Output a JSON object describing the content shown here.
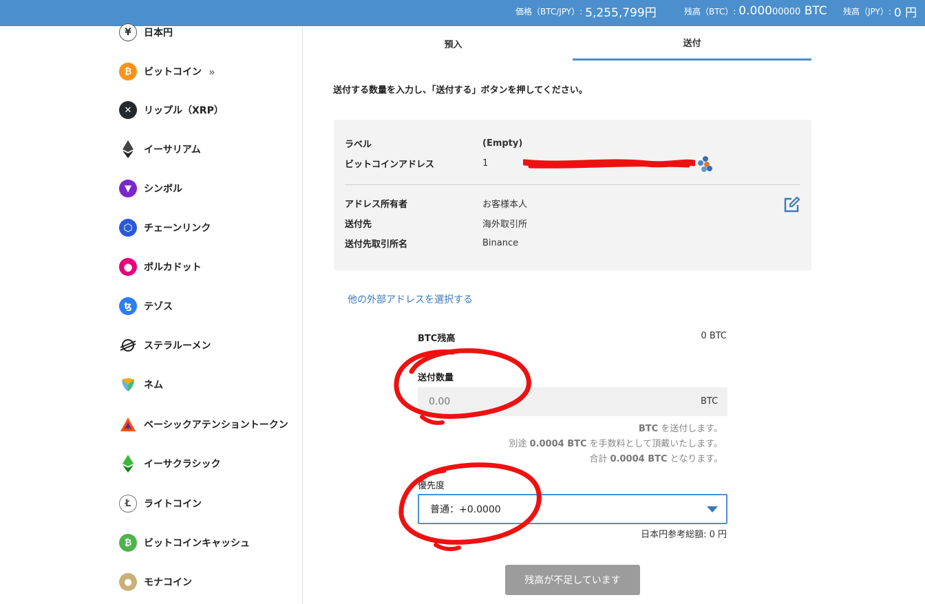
{
  "topbar": {
    "price_label": "価格（BTC/JPY）:",
    "price_value": "5,255,799円",
    "btc_balance_label": "残高（BTC）:",
    "btc_balance_main": "0.000",
    "btc_balance_small": "00000",
    "btc_balance_unit": " BTC",
    "jpy_balance_label": "残高（JPY）:",
    "jpy_balance_value": "0 円"
  },
  "sidebar": {
    "items": [
      {
        "label": "日本円",
        "icon": "yen-icon"
      },
      {
        "label": "ビットコイン",
        "icon": "bitcoin-icon",
        "chevron": "»"
      },
      {
        "label": "リップル（XRP）",
        "icon": "xrp-icon"
      },
      {
        "label": "イーサリアム",
        "icon": "ethereum-icon"
      },
      {
        "label": "シンボル",
        "icon": "symbol-icon"
      },
      {
        "label": "チェーンリンク",
        "icon": "chainlink-icon"
      },
      {
        "label": "ポルカドット",
        "icon": "polkadot-icon"
      },
      {
        "label": "テゾス",
        "icon": "tezos-icon"
      },
      {
        "label": "ステラルーメン",
        "icon": "stellar-icon"
      },
      {
        "label": "ネム",
        "icon": "nem-icon"
      },
      {
        "label": "ベーシックアテンショントークン",
        "icon": "bat-icon"
      },
      {
        "label": "イーサクラシック",
        "icon": "etc-icon"
      },
      {
        "label": "ライトコイン",
        "icon": "litecoin-icon"
      },
      {
        "label": "ビットコインキャッシュ",
        "icon": "bch-icon"
      },
      {
        "label": "モナコイン",
        "icon": "monacoin-icon"
      }
    ]
  },
  "tabs": {
    "deposit": "預入",
    "send": "送付"
  },
  "instruction": "送付する数量を入力し、「送付する」ボタンを押してください。",
  "address_card": {
    "label_key": "ラベル",
    "label_value": "(Empty)",
    "address_key": "ビットコインアドレス",
    "address_value": "1",
    "owner_key": "アドレス所有者",
    "owner_value": "お客様本人",
    "destination_key": "送付先",
    "destination_value": "海外取引所",
    "exchange_key": "送付先取引所名",
    "exchange_value": "Binance"
  },
  "select_other_link": "他の外部アドレスを選択する",
  "form": {
    "balance_label": "BTC残高",
    "balance_value": "0 BTC",
    "amount_label": "送付数量",
    "amount_placeholder": "0.00",
    "amount_unit": "BTC",
    "note_line1_unit": "BTC",
    "note_line1_text": " を送付します。",
    "note_line2_prefix": "別途 ",
    "note_line2_value": "0.0004 BTC",
    "note_line2_suffix": " を手数料として頂戴いたします。",
    "note_line3_prefix": "合計 ",
    "note_line3_value": "0.0004 BTC",
    "note_line3_suffix": " となります。",
    "priority_label": "優先度",
    "priority_selected": "普通：+0.0000",
    "jpy_total": "日本円参考総額: 0 円",
    "submit_label": "残高が不足しています"
  },
  "colors": {
    "topbar": "#4b8fcd",
    "accent": "#4b8fcd",
    "link": "#3a78b8",
    "disabled_button": "#9c9c9c",
    "annotation_red": "#ee1111"
  }
}
